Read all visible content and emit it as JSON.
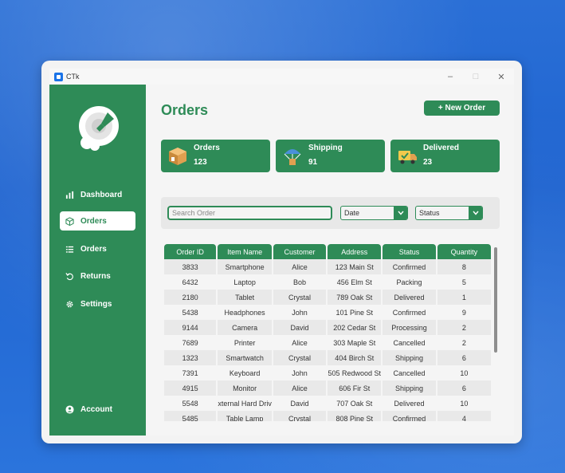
{
  "window": {
    "title": "CTk",
    "minimize": "–",
    "maximize": "□",
    "close": "✕"
  },
  "sidebar": {
    "items": [
      {
        "label": "Dashboard",
        "icon": "bar-chart-icon",
        "active": false
      },
      {
        "label": "Orders",
        "icon": "box-icon",
        "active": true
      },
      {
        "label": "Orders",
        "icon": "list-icon",
        "active": false
      },
      {
        "label": "Returns",
        "icon": "undo-icon",
        "active": false
      },
      {
        "label": "Settings",
        "icon": "gear-icon",
        "active": false
      }
    ],
    "account": {
      "label": "Account",
      "icon": "user-icon"
    }
  },
  "main": {
    "title": "Orders",
    "new_order_label": "+ New Order",
    "stats": [
      {
        "label": "Orders",
        "value": "123",
        "icon": "package-icon"
      },
      {
        "label": "Shipping",
        "value": "91",
        "icon": "parachute-box-icon"
      },
      {
        "label": "Delivered",
        "value": "23",
        "icon": "delivery-truck-icon"
      }
    ],
    "filters": {
      "search_placeholder": "Search Order",
      "date_value": "Date",
      "status_value": "Status"
    },
    "table": {
      "columns": [
        "Order ID",
        "Item Name",
        "Customer",
        "Address",
        "Status",
        "Quantity"
      ],
      "rows": [
        [
          "3833",
          "Smartphone",
          "Alice",
          "123 Main St",
          "Confirmed",
          "8"
        ],
        [
          "6432",
          "Laptop",
          "Bob",
          "456 Elm St",
          "Packing",
          "5"
        ],
        [
          "2180",
          "Tablet",
          "Crystal",
          "789 Oak St",
          "Delivered",
          "1"
        ],
        [
          "5438",
          "Headphones",
          "John",
          "101 Pine St",
          "Confirmed",
          "9"
        ],
        [
          "9144",
          "Camera",
          "David",
          "202 Cedar St",
          "Processing",
          "2"
        ],
        [
          "7689",
          "Printer",
          "Alice",
          "303 Maple St",
          "Cancelled",
          "2"
        ],
        [
          "1323",
          "Smartwatch",
          "Crystal",
          "404 Birch St",
          "Shipping",
          "6"
        ],
        [
          "7391",
          "Keyboard",
          "John",
          "505 Redwood St",
          "Cancelled",
          "10"
        ],
        [
          "4915",
          "Monitor",
          "Alice",
          "606 Fir St",
          "Shipping",
          "6"
        ],
        [
          "5548",
          "xternal Hard Driv",
          "David",
          "707 Oak St",
          "Delivered",
          "10"
        ],
        [
          "5485",
          "Table Lamp",
          "Crystal",
          "808 Pine St",
          "Confirmed",
          "4"
        ]
      ]
    }
  },
  "colors": {
    "accent": "#2e8b57",
    "background": "#f5f5f5",
    "desktop": "#2a6fd6"
  }
}
